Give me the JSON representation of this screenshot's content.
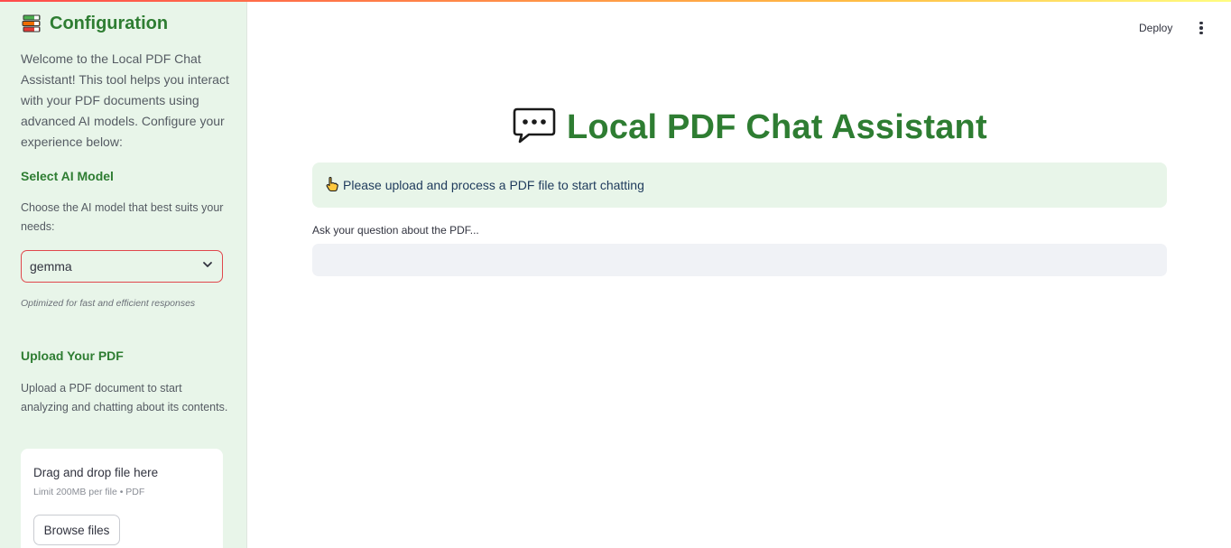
{
  "app": {
    "accent_color": "#2e7d32",
    "sidebar_bg": "#e8f5e9"
  },
  "sidebar": {
    "title": "Configuration",
    "title_icon": "books-icon",
    "intro": "Welcome to the Local PDF Chat Assistant! This tool helps you interact with your PDF documents using advanced AI models. Configure your experience below:",
    "model_section": {
      "heading": "Select AI Model",
      "description": "Choose the AI model that best suits your needs:",
      "selected": "gemma",
      "caption": "Optimized for fast and efficient responses"
    },
    "upload_section": {
      "heading": "Upload Your PDF",
      "description": "Upload a PDF document to start analyzing and chatting about its contents.",
      "drag_text": "Drag and drop file here",
      "limit_text": "Limit 200MB per file • PDF",
      "browse_label": "Browse files"
    }
  },
  "header": {
    "deploy_label": "Deploy",
    "menu_icon": "kebab-menu-icon"
  },
  "main": {
    "title": "Local PDF Chat Assistant",
    "title_icon": "speech-bubble-icon",
    "info_icon": "pointing-hand-icon",
    "info_message": "Please upload and process a PDF file to start chatting",
    "question_label": "Ask your question about the PDF...",
    "question_value": ""
  }
}
